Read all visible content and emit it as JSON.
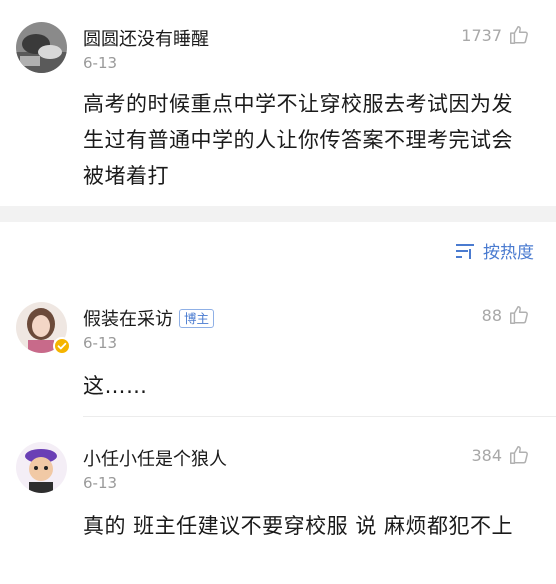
{
  "sort": {
    "label": "按热度",
    "icon": "sort-lines-icon"
  },
  "comments": [
    {
      "username": "圆圆还没有睡醒",
      "date": "6-13",
      "likes": "1737",
      "text": "高考的时候重点中学不让穿校服去考试因为发生过有普通中学的人让你传答案不理考完试会被堵着打",
      "badge": ""
    },
    {
      "username": "假装在采访",
      "badge": "博主",
      "date": "6-13",
      "likes": "88",
      "text": "这……",
      "verified": true
    },
    {
      "username": "小任小任是个狼人",
      "date": "6-13",
      "likes": "384",
      "text": "真的 班主任建议不要穿校服 说 麻烦都犯不上",
      "badge": ""
    }
  ],
  "colors": {
    "accent": "#4a7bd0",
    "muted": "#9a9a9a",
    "band": "#f2f2f2",
    "verified": "#f5b400"
  }
}
